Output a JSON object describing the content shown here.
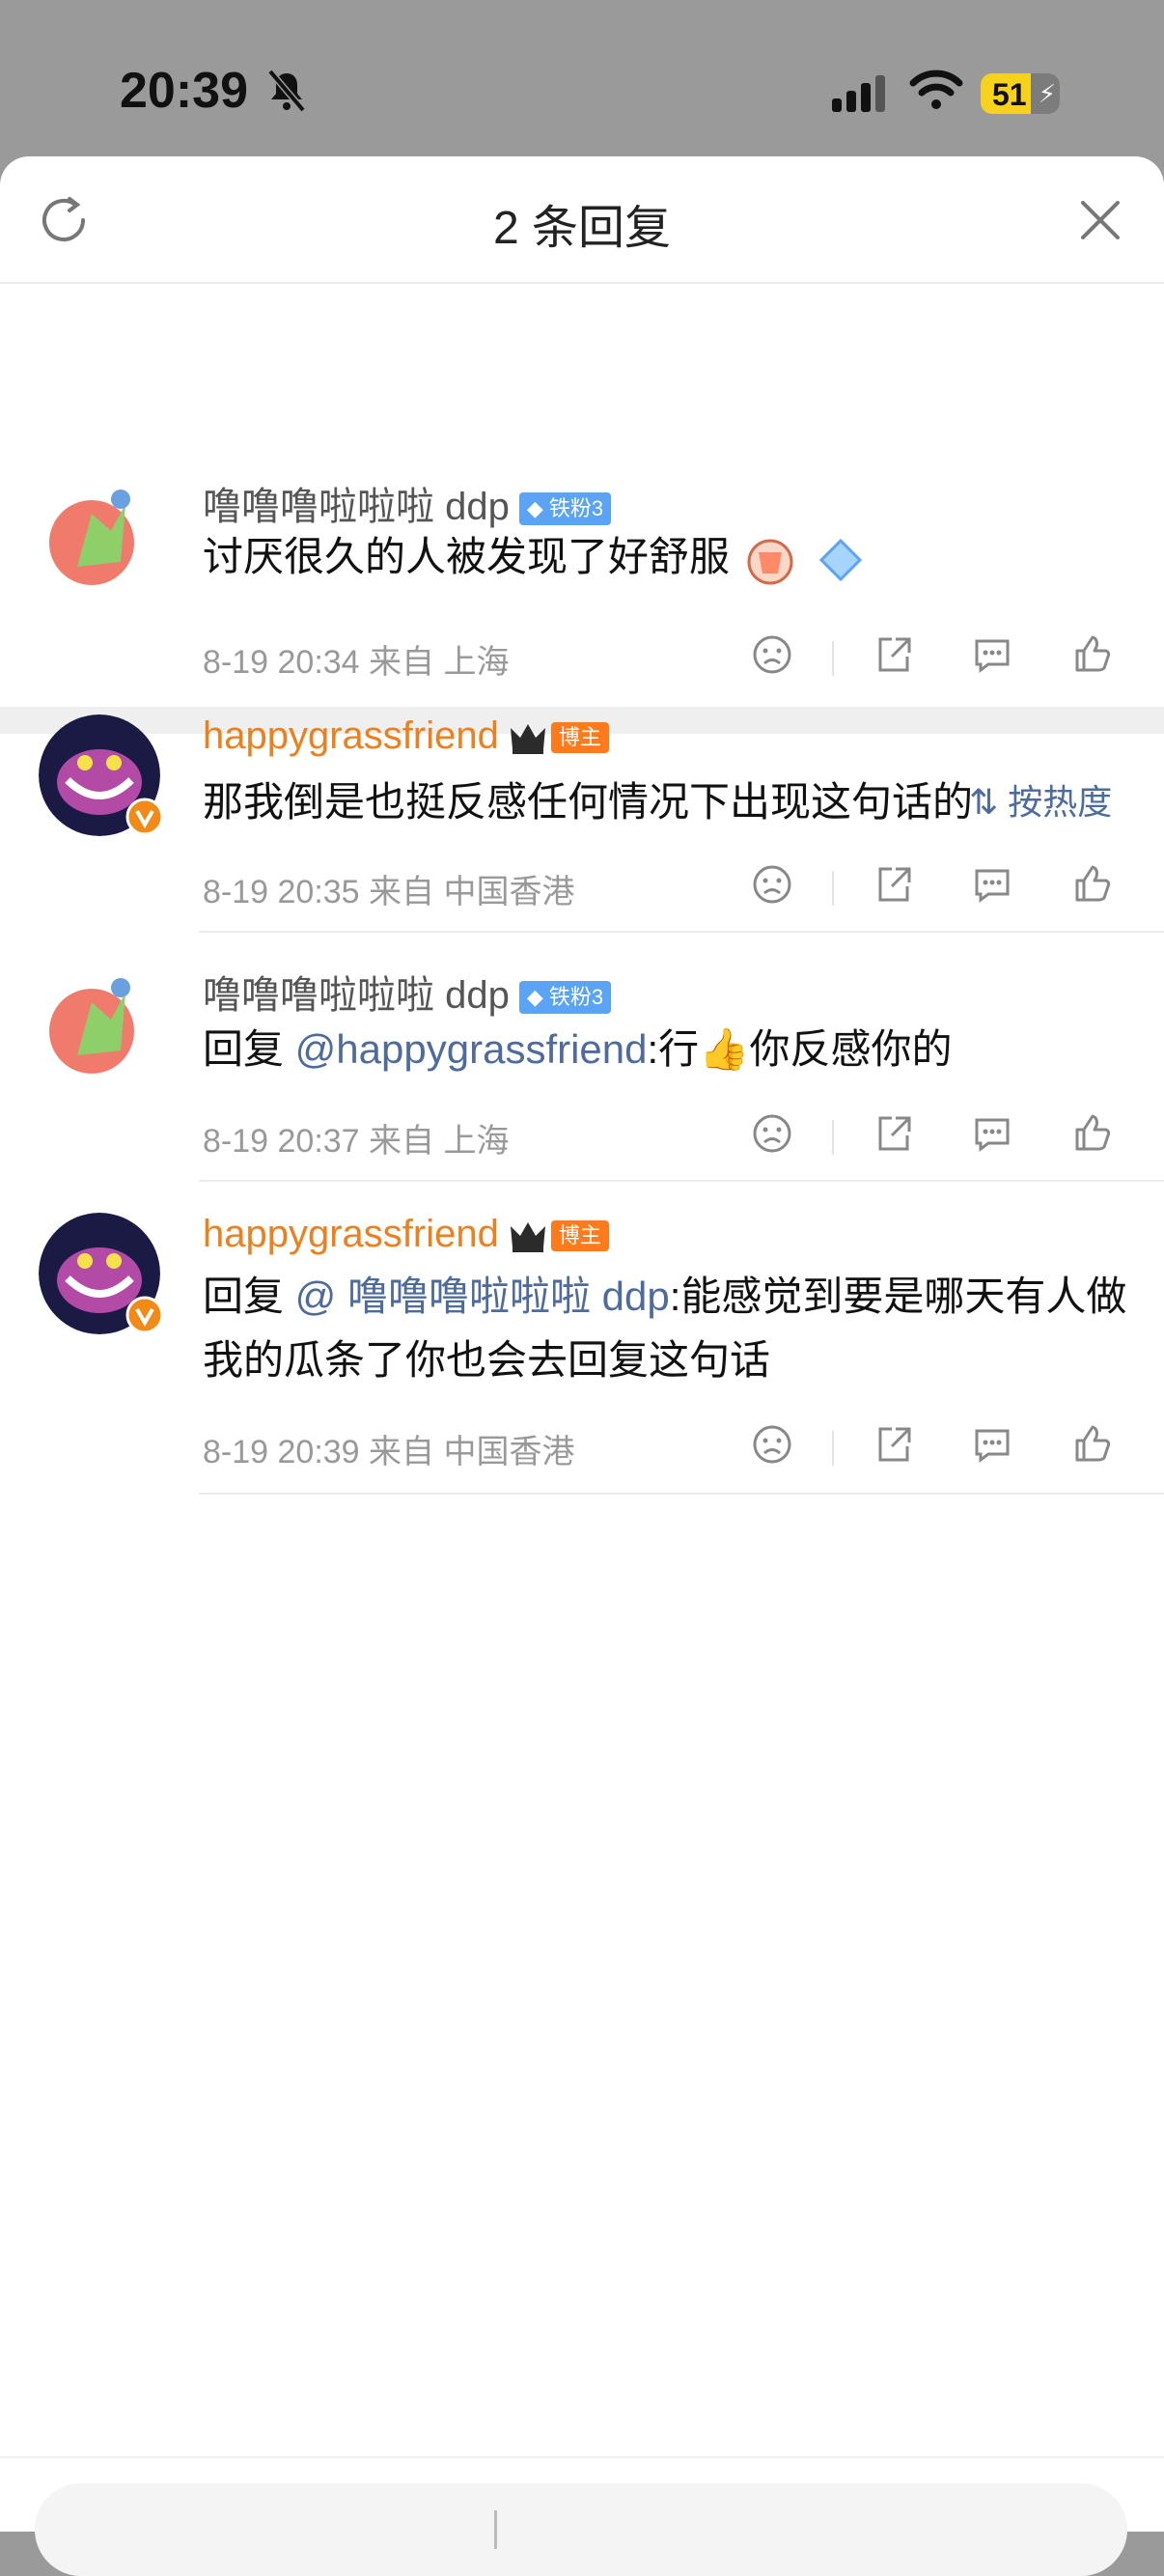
{
  "status_bar": {
    "time": "20:39",
    "battery": "51"
  },
  "header": {
    "title": "2 条回复"
  },
  "sort": {
    "label": "按热度"
  },
  "parent": {
    "name": "噜噜噜啦啦啦 ddp",
    "badge": "铁粉3",
    "text": "讨厌很久的人被发现了好舒服",
    "meta": "8-19 20:34 来自 上海"
  },
  "replies": [
    {
      "name": "happygrassfriend",
      "badge": "博主",
      "text": "那我倒是也挺反感任何情况下出现这句话的",
      "meta": "8-19 20:35 来自 中国香港"
    },
    {
      "name": "噜噜噜啦啦啦 ddp",
      "badge": "铁粉3",
      "prefix": "回复 ",
      "mention": "@happygrassfriend",
      "text": ":行",
      "text2": "你反感你的",
      "meta": "8-19 20:37 来自 上海"
    },
    {
      "name": "happygrassfriend",
      "badge": "博主",
      "prefix": "回复 ",
      "mention": "@ 噜噜噜啦啦啦 ddp",
      "text": ":能感觉到要是哪天有人做我的瓜条了你也会去回复这句话",
      "meta": "8-19 20:39 来自 中国香港"
    }
  ],
  "icons": [
    "bell-muted-icon",
    "signal-icon",
    "wifi-icon",
    "battery-icon",
    "refresh-icon",
    "close-icon",
    "dislike-icon",
    "share-icon",
    "comment-icon",
    "like-icon",
    "sort-icon"
  ]
}
